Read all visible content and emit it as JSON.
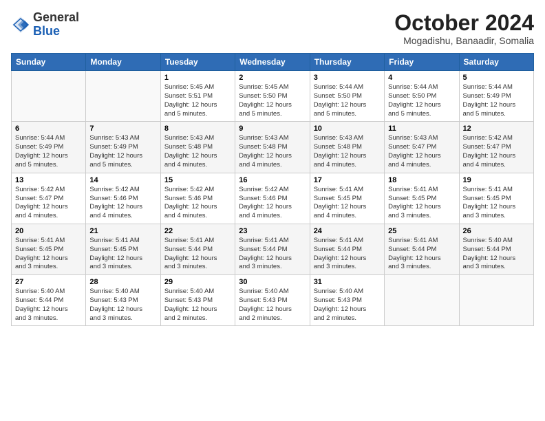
{
  "logo": {
    "general": "General",
    "blue": "Blue"
  },
  "header": {
    "month": "October 2024",
    "location": "Mogadishu, Banaadir, Somalia"
  },
  "weekdays": [
    "Sunday",
    "Monday",
    "Tuesday",
    "Wednesday",
    "Thursday",
    "Friday",
    "Saturday"
  ],
  "weeks": [
    [
      {
        "day": "",
        "info": ""
      },
      {
        "day": "",
        "info": ""
      },
      {
        "day": "1",
        "info": "Sunrise: 5:45 AM\nSunset: 5:51 PM\nDaylight: 12 hours\nand 5 minutes."
      },
      {
        "day": "2",
        "info": "Sunrise: 5:45 AM\nSunset: 5:50 PM\nDaylight: 12 hours\nand 5 minutes."
      },
      {
        "day": "3",
        "info": "Sunrise: 5:44 AM\nSunset: 5:50 PM\nDaylight: 12 hours\nand 5 minutes."
      },
      {
        "day": "4",
        "info": "Sunrise: 5:44 AM\nSunset: 5:50 PM\nDaylight: 12 hours\nand 5 minutes."
      },
      {
        "day": "5",
        "info": "Sunrise: 5:44 AM\nSunset: 5:49 PM\nDaylight: 12 hours\nand 5 minutes."
      }
    ],
    [
      {
        "day": "6",
        "info": "Sunrise: 5:44 AM\nSunset: 5:49 PM\nDaylight: 12 hours\nand 5 minutes."
      },
      {
        "day": "7",
        "info": "Sunrise: 5:43 AM\nSunset: 5:49 PM\nDaylight: 12 hours\nand 5 minutes."
      },
      {
        "day": "8",
        "info": "Sunrise: 5:43 AM\nSunset: 5:48 PM\nDaylight: 12 hours\nand 4 minutes."
      },
      {
        "day": "9",
        "info": "Sunrise: 5:43 AM\nSunset: 5:48 PM\nDaylight: 12 hours\nand 4 minutes."
      },
      {
        "day": "10",
        "info": "Sunrise: 5:43 AM\nSunset: 5:48 PM\nDaylight: 12 hours\nand 4 minutes."
      },
      {
        "day": "11",
        "info": "Sunrise: 5:43 AM\nSunset: 5:47 PM\nDaylight: 12 hours\nand 4 minutes."
      },
      {
        "day": "12",
        "info": "Sunrise: 5:42 AM\nSunset: 5:47 PM\nDaylight: 12 hours\nand 4 minutes."
      }
    ],
    [
      {
        "day": "13",
        "info": "Sunrise: 5:42 AM\nSunset: 5:47 PM\nDaylight: 12 hours\nand 4 minutes."
      },
      {
        "day": "14",
        "info": "Sunrise: 5:42 AM\nSunset: 5:46 PM\nDaylight: 12 hours\nand 4 minutes."
      },
      {
        "day": "15",
        "info": "Sunrise: 5:42 AM\nSunset: 5:46 PM\nDaylight: 12 hours\nand 4 minutes."
      },
      {
        "day": "16",
        "info": "Sunrise: 5:42 AM\nSunset: 5:46 PM\nDaylight: 12 hours\nand 4 minutes."
      },
      {
        "day": "17",
        "info": "Sunrise: 5:41 AM\nSunset: 5:45 PM\nDaylight: 12 hours\nand 4 minutes."
      },
      {
        "day": "18",
        "info": "Sunrise: 5:41 AM\nSunset: 5:45 PM\nDaylight: 12 hours\nand 3 minutes."
      },
      {
        "day": "19",
        "info": "Sunrise: 5:41 AM\nSunset: 5:45 PM\nDaylight: 12 hours\nand 3 minutes."
      }
    ],
    [
      {
        "day": "20",
        "info": "Sunrise: 5:41 AM\nSunset: 5:45 PM\nDaylight: 12 hours\nand 3 minutes."
      },
      {
        "day": "21",
        "info": "Sunrise: 5:41 AM\nSunset: 5:45 PM\nDaylight: 12 hours\nand 3 minutes."
      },
      {
        "day": "22",
        "info": "Sunrise: 5:41 AM\nSunset: 5:44 PM\nDaylight: 12 hours\nand 3 minutes."
      },
      {
        "day": "23",
        "info": "Sunrise: 5:41 AM\nSunset: 5:44 PM\nDaylight: 12 hours\nand 3 minutes."
      },
      {
        "day": "24",
        "info": "Sunrise: 5:41 AM\nSunset: 5:44 PM\nDaylight: 12 hours\nand 3 minutes."
      },
      {
        "day": "25",
        "info": "Sunrise: 5:41 AM\nSunset: 5:44 PM\nDaylight: 12 hours\nand 3 minutes."
      },
      {
        "day": "26",
        "info": "Sunrise: 5:40 AM\nSunset: 5:44 PM\nDaylight: 12 hours\nand 3 minutes."
      }
    ],
    [
      {
        "day": "27",
        "info": "Sunrise: 5:40 AM\nSunset: 5:44 PM\nDaylight: 12 hours\nand 3 minutes."
      },
      {
        "day": "28",
        "info": "Sunrise: 5:40 AM\nSunset: 5:43 PM\nDaylight: 12 hours\nand 3 minutes."
      },
      {
        "day": "29",
        "info": "Sunrise: 5:40 AM\nSunset: 5:43 PM\nDaylight: 12 hours\nand 2 minutes."
      },
      {
        "day": "30",
        "info": "Sunrise: 5:40 AM\nSunset: 5:43 PM\nDaylight: 12 hours\nand 2 minutes."
      },
      {
        "day": "31",
        "info": "Sunrise: 5:40 AM\nSunset: 5:43 PM\nDaylight: 12 hours\nand 2 minutes."
      },
      {
        "day": "",
        "info": ""
      },
      {
        "day": "",
        "info": ""
      }
    ]
  ]
}
